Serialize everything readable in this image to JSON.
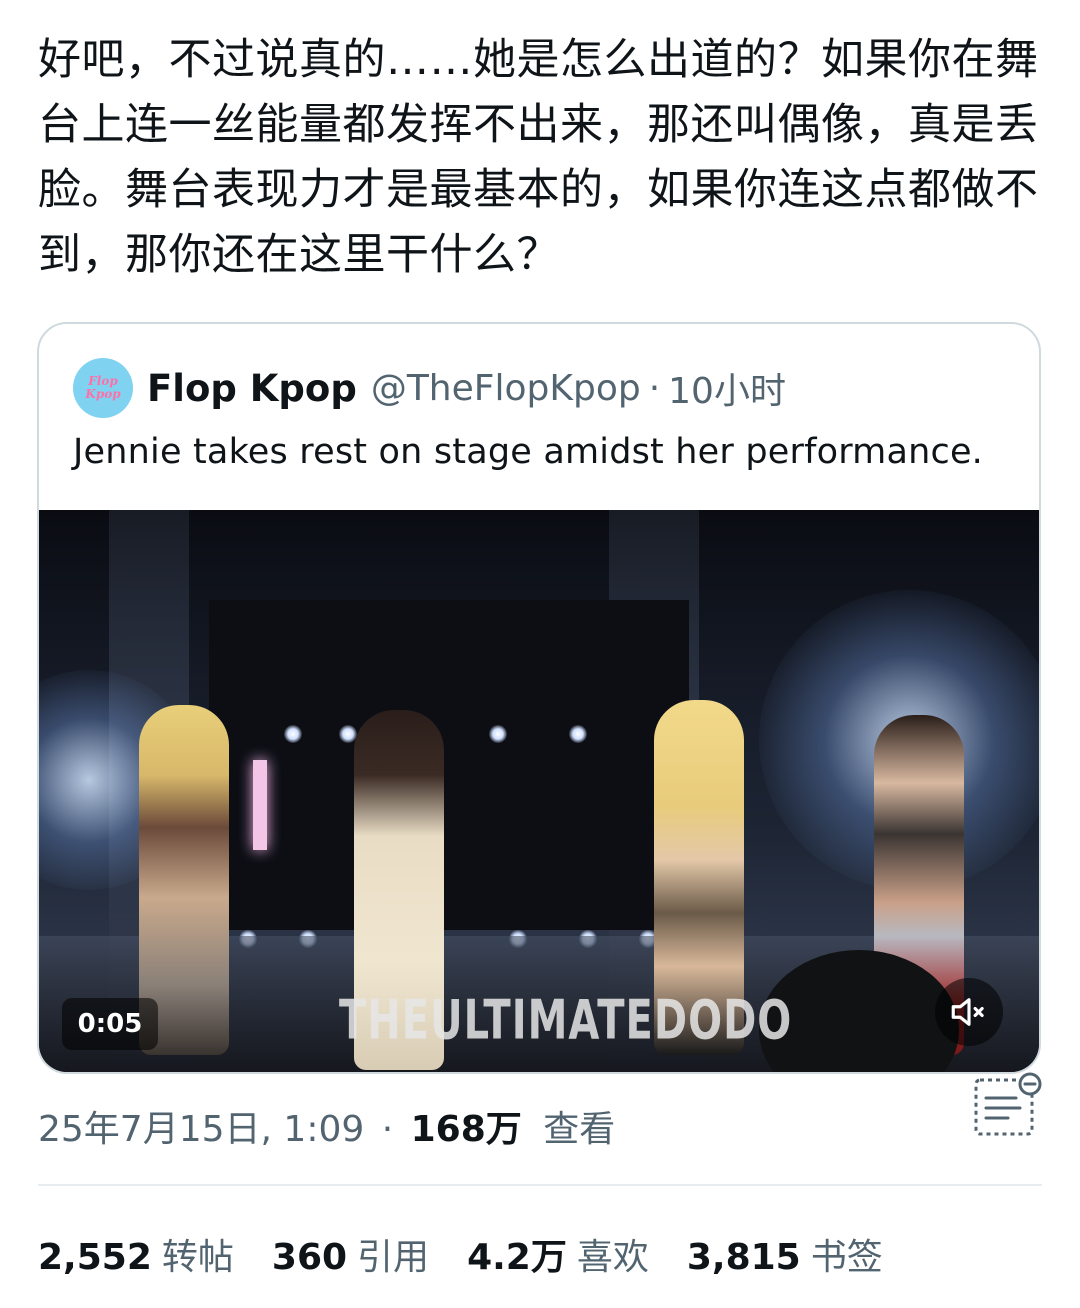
{
  "tweet": {
    "text": "好吧，不过说真的……她是怎么出道的？如果你在舞台上连一丝能量都发挥不出来，那还叫偶像，真是丢脸。舞台表现力才是最基本的，如果你连这点都做不到，那你还在这里干什么？"
  },
  "quote": {
    "avatar_top": "Flop",
    "avatar_bottom": "Kpop",
    "author_name": "Flop Kpop",
    "author_handle": "@TheFlopKpop",
    "separator": "·",
    "time_ago": "10小时",
    "text": "Jennie takes rest on stage amidst her performance.",
    "video": {
      "timecode": "0:05",
      "watermark": "THEULTIMATEDODO"
    }
  },
  "meta": {
    "date_time": "25年7月15日, 1:09",
    "separator": "·",
    "views_count": "168万",
    "views_label": "查看"
  },
  "stats": [
    {
      "count": "2,552",
      "label": "转帖"
    },
    {
      "count": "360",
      "label": "引用"
    },
    {
      "count": "4.2万",
      "label": "喜欢"
    },
    {
      "count": "3,815",
      "label": "书签"
    }
  ],
  "icons": {
    "mute": "speaker-muted-icon",
    "summary": "summary-icon"
  },
  "colors": {
    "text": "#0f1419",
    "secondary": "#536471",
    "border": "#cfd9de"
  }
}
